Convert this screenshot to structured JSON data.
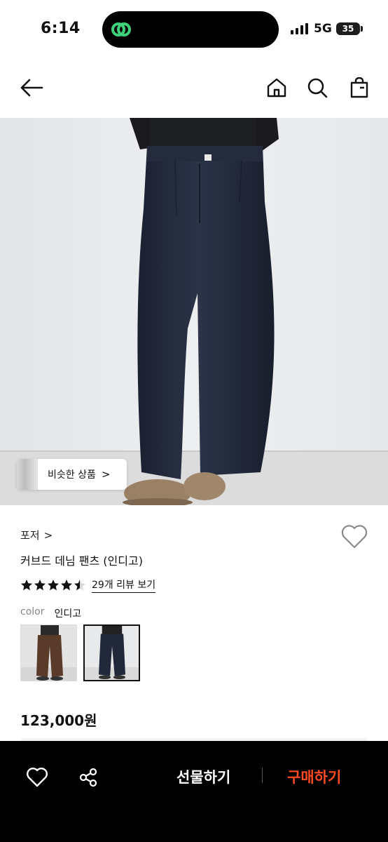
{
  "status_bar": {
    "time": "6:14",
    "network": "5G",
    "battery": "35"
  },
  "nav": {
    "icons": [
      "back-arrow-icon",
      "home-icon",
      "search-icon",
      "shopping-bag-icon"
    ]
  },
  "product": {
    "similar_button_label": "비슷한 상품",
    "similar_button_chevron": ">",
    "brand": "포저",
    "brand_chevron": ">",
    "title": "커브드 데님 팬츠 (인디고)",
    "rating": 4.5,
    "review_link": "29개 리뷰 보기",
    "color_key": "color",
    "color_value": "인디고",
    "swatches": [
      {
        "name": "brown",
        "selected": false
      },
      {
        "name": "indigo",
        "selected": true
      }
    ],
    "price": "123,000원"
  },
  "bottom_bar": {
    "gift_label": "선물하기",
    "buy_label": "구매하기",
    "icons": [
      "heart-icon",
      "share-icon"
    ]
  },
  "colors": {
    "buy_accent": "#ff4a24",
    "app_logo": "#2ecc71",
    "denim": "#1f2738",
    "brown_denim": "#5a3a28"
  }
}
